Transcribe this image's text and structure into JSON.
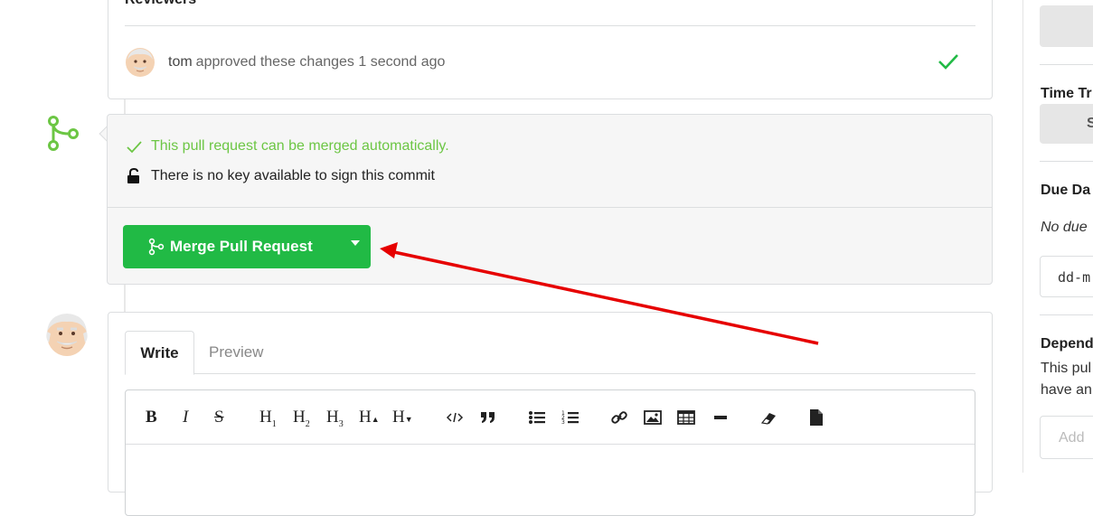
{
  "reviewers": {
    "title": "Reviewers",
    "entry": {
      "user": "tom",
      "text": "approved these changes 1 second ago"
    }
  },
  "merge": {
    "status_text": "This pull request can be merged automatically.",
    "sign_text": "There is no key available to sign this commit",
    "button_label": "Merge Pull Request"
  },
  "comment": {
    "tabs": [
      "Write",
      "Preview"
    ],
    "toolbar": {
      "bold": "B",
      "italic": "I",
      "strike": "S",
      "h1": "H",
      "h1_sub": "1",
      "h2": "H",
      "h2_sub": "2",
      "h3": "H",
      "h3_sub": "3",
      "hinc": "H",
      "hdec": "H"
    }
  },
  "sidebar": {
    "time_tracking_title": "Time Tr",
    "time_tracking_btn": "S",
    "due_date_title": "Due Da",
    "no_due": "No due",
    "date_input": "dd-m",
    "dependencies_title": "Depend",
    "dependencies_desc_1": "This pul",
    "dependencies_desc_2": "have an",
    "add_placeholder": "Add"
  },
  "colors": {
    "success": "#21ba45",
    "success_text": "#6cc644",
    "annotation": "#e60000"
  },
  "icons": [
    "check-icon",
    "git-merge-icon",
    "unlock-icon",
    "caret-down-icon",
    "avatar"
  ]
}
